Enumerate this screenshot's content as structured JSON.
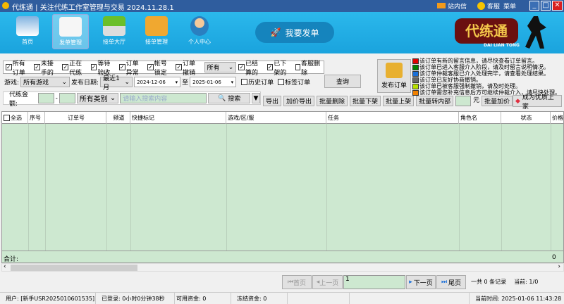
{
  "window": {
    "title": "代练通 | 关注代练工作室管理与交易 2024.11.28.1",
    "mail": "站内信",
    "service": "客服",
    "menu": "菜单"
  },
  "nav": [
    {
      "label": "首页"
    },
    {
      "label": "发单管理"
    },
    {
      "label": "接单大厅"
    },
    {
      "label": "接单管理"
    },
    {
      "label": "个人中心"
    }
  ],
  "publish_big": "我要发单",
  "logo": {
    "text": "代练通",
    "sub": "DAI LIAN TONG"
  },
  "filters": {
    "checks": [
      {
        "label": "所有订单",
        "checked": true
      },
      {
        "label": "未接手的",
        "checked": true
      },
      {
        "label": "正在代练",
        "checked": true
      },
      {
        "label": "等待验收",
        "checked": true
      },
      {
        "label": "订单异常",
        "checked": true
      },
      {
        "label": "帐号锁定",
        "checked": true
      },
      {
        "label": "订单撤销",
        "checked": true
      }
    ],
    "status_select": "所有",
    "checks2": [
      {
        "label": "已结算的",
        "checked": true
      },
      {
        "label": "已下架的",
        "checked": true
      },
      {
        "label": "客服删除",
        "checked": false
      }
    ],
    "game_label": "游戏:",
    "game": "所有游戏",
    "date_label": "发布日期:",
    "date_range": "最近1月",
    "date_from": "2024-12-06",
    "to": "至",
    "date_to": "2025-01-06",
    "history": "历史订单",
    "tag": "标签订单",
    "query": "查询",
    "publish": "发布订单",
    "amount_label": "代练金额:",
    "dash": "-",
    "category": "所有类别",
    "search_placeholder": "请输入搜索内容",
    "search": "搜索"
  },
  "actions": [
    "导出",
    "加价导出",
    "批量删除",
    "批量下架",
    "批量上架",
    "批量转内部"
  ],
  "yuan": "元",
  "batch_raise": "批量加价",
  "premium": "成为优质上家",
  "legend": [
    {
      "color": "#e00000",
      "text": "该订单有新的留言信息，请尽快查看订单留言。"
    },
    {
      "color": "#008000",
      "text": "该订单已进入客服介入阶段，请及时留言说明情况。"
    },
    {
      "color": "#1a6fd8",
      "text": "该订单仲裁客服已介入处理完毕，请查看处理结果。"
    },
    {
      "color": "#666666",
      "text": "该订单已友好协商撤销。"
    },
    {
      "color": "#b8e000",
      "text": "该订单已被客服强制撤销，请及时处理。"
    },
    {
      "color": "#f08000",
      "text": "该订单需您补充信息后方可继续仲裁介入，请尽快处理。"
    }
  ],
  "table": {
    "select_all": "全选",
    "columns": [
      "序号",
      "订单号",
      "频道",
      "快捷标记",
      "游戏/区/服",
      "任务",
      "角色名",
      "状态",
      "价格"
    ],
    "total_label": "合计:",
    "total_value": "0"
  },
  "pager": {
    "first": "首页",
    "prev": "上一页",
    "page": "1",
    "next": "下一页",
    "last": "尾页",
    "total": "一共 0 条记录",
    "current": "当前: 1/0"
  },
  "status": {
    "user": "用户: [新手USR2025010601535]",
    "login": "已登录: 0小时0分钟38秒",
    "available": "可用资金: 0",
    "frozen": "冻结资金: 0",
    "time": "当前时间: 2025-01-06 11:43:28"
  }
}
